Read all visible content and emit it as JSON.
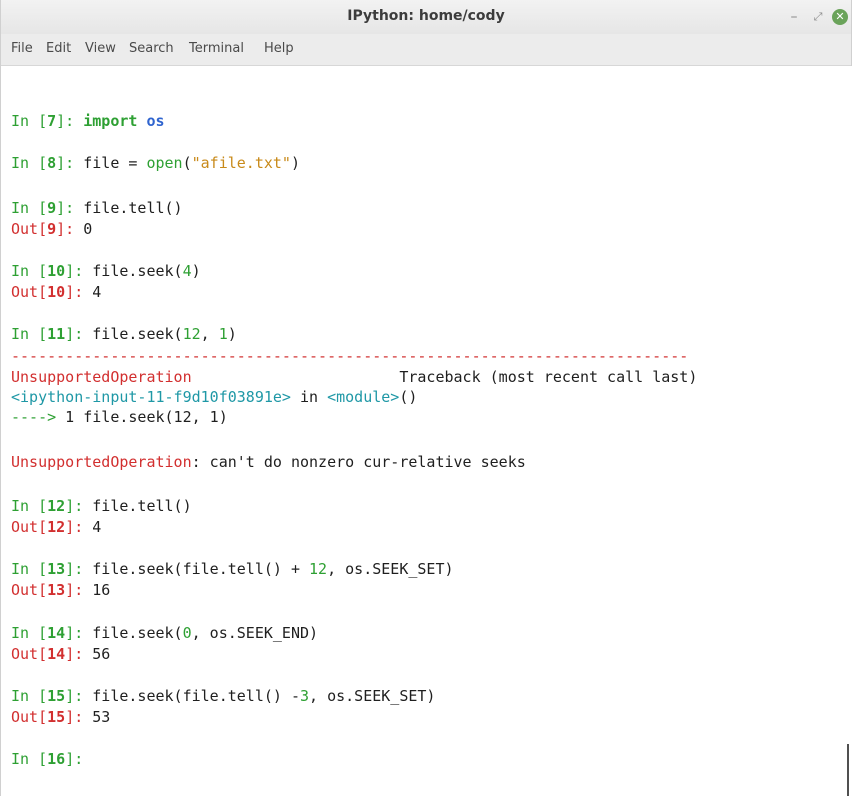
{
  "window": {
    "title": "IPython: home/cody",
    "minimize_glyph": "–",
    "maximize_glyph": "⤢",
    "close_glyph": "✕"
  },
  "menu": {
    "items": [
      "File",
      "Edit",
      "View",
      "Search",
      "Terminal",
      "Help"
    ]
  },
  "colors": {
    "prompt_green": "#2ea033",
    "out_red": "#d22f2f",
    "name_blue": "#2f64cf",
    "string_orange": "#c88a1a",
    "error_red": "#d22f2f",
    "link_cyan": "#1f98a6"
  },
  "console": {
    "in_prefix": "In [",
    "out_prefix": "Out[",
    "prompt_suffix": "]: ",
    "c7": {
      "n": "7",
      "kw": "import",
      "mod": "os"
    },
    "c8": {
      "n": "8",
      "a": "file = ",
      "fn": "open",
      "b": "(",
      "str": "\"afile.txt\"",
      "c": ")"
    },
    "c9": {
      "n": "9",
      "code": "file.tell()",
      "out": "0"
    },
    "c10": {
      "n": "10",
      "a": "file.seek(",
      "num": "4",
      "b": ")",
      "out": "4"
    },
    "c11": {
      "n": "11",
      "a": "file.seek(",
      "num1": "12",
      "sep": ", ",
      "num2": "1",
      "b": ")"
    },
    "tb": {
      "rule": "---------------------------------------------------------------------------",
      "exc": "UnsupportedOperation",
      "gap": "                       ",
      "header": "Traceback (most recent call last)",
      "input_name": "<ipython-input-11-f9d10f03891e>",
      "in_word": " in ",
      "module_name": "<module>",
      "module_parens": "()",
      "arrow": "---->",
      "arrow_num": " 1",
      "arrow_code": " file.seek(12, 1)",
      "err_name": "UnsupportedOperation",
      "err_msg": ": can't do nonzero cur-relative seeks"
    },
    "c12": {
      "n": "12",
      "code": "file.tell()",
      "out": "4"
    },
    "c13": {
      "n": "13",
      "a": "file.seek(file.tell() + ",
      "num": "12",
      "b": ", os.SEEK_SET)",
      "out": "16"
    },
    "c14": {
      "n": "14",
      "a": "file.seek(",
      "num": "0",
      "b": ", os.SEEK_END)",
      "out": "56"
    },
    "c15": {
      "n": "15",
      "a": "file.seek(file.tell() -",
      "num": "3",
      "b": ", os.SEEK_SET)",
      "out": "53"
    },
    "c16": {
      "n": "16"
    }
  }
}
